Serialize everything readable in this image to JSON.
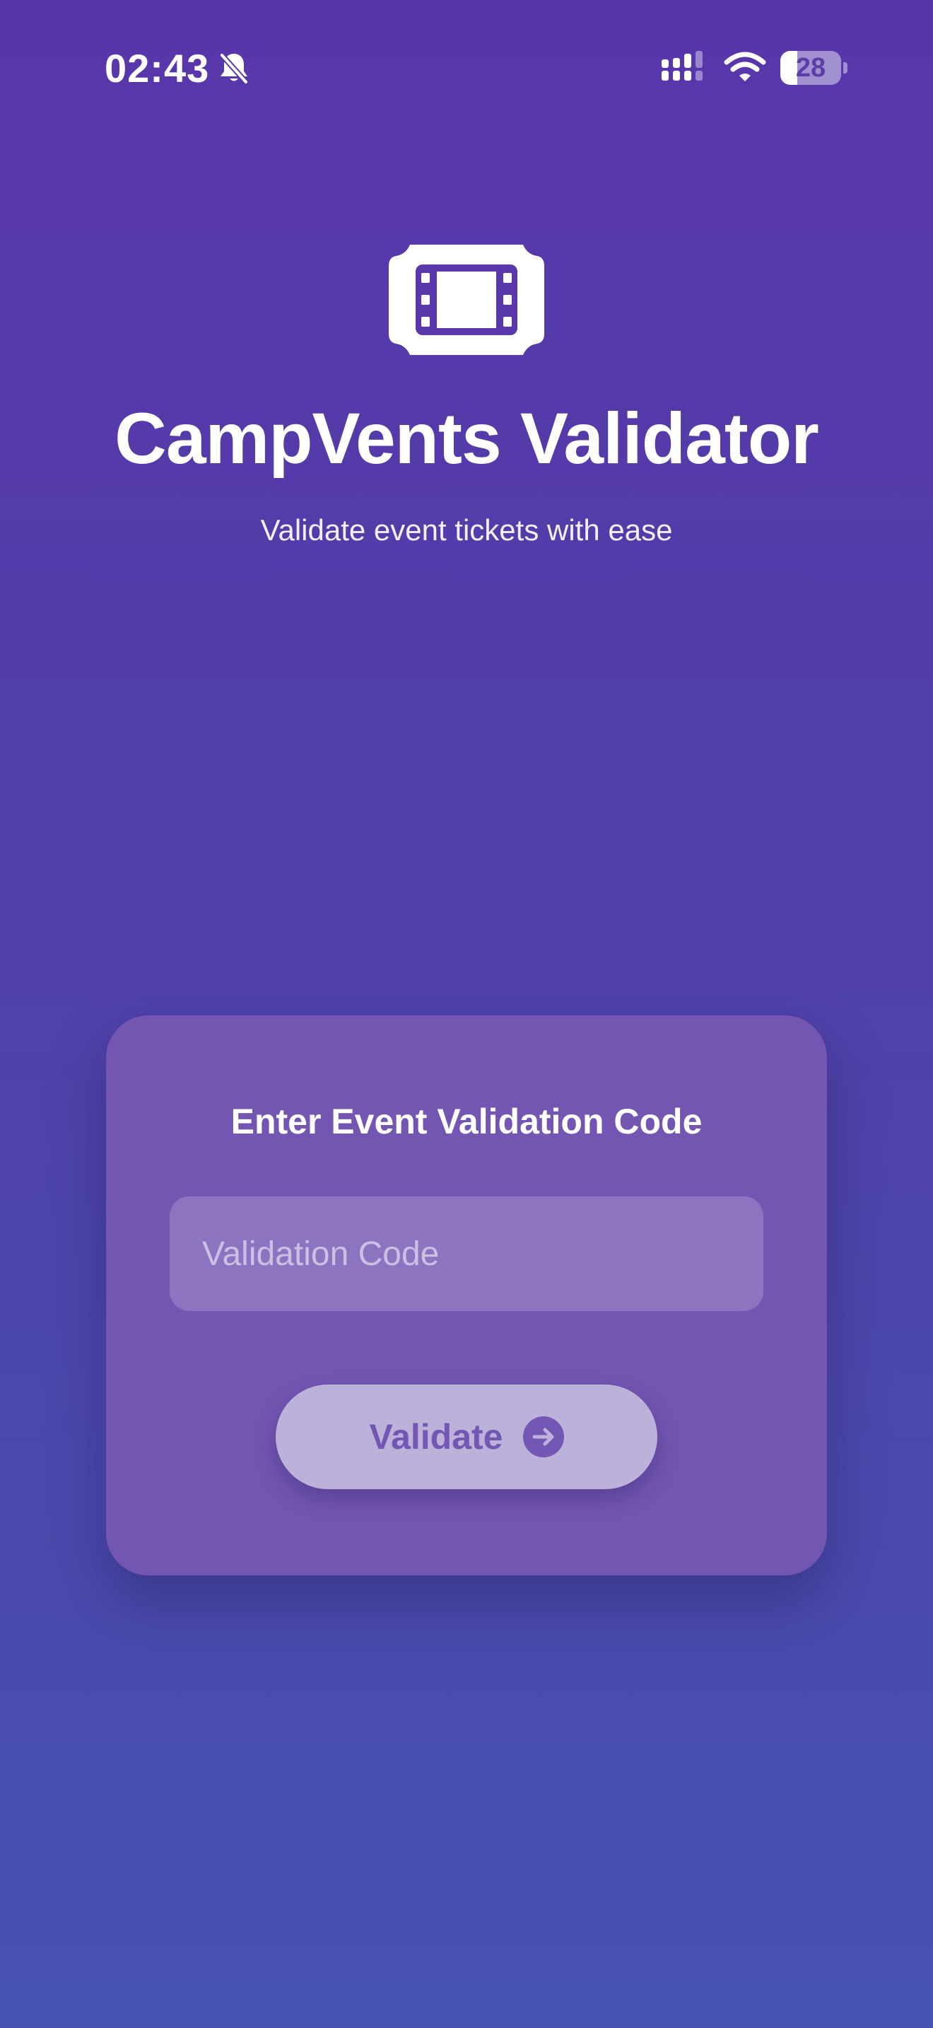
{
  "status_bar": {
    "time": "02:43",
    "battery_level": "28",
    "battery_fraction": 0.28,
    "icons": [
      "bell-slash-icon",
      "cellular-signal-icon",
      "wifi-icon",
      "battery-icon"
    ]
  },
  "header": {
    "logo_icon": "film-ticket-icon",
    "title": "CampVents Validator",
    "subtitle": "Validate event tickets with ease"
  },
  "card": {
    "title": "Enter Event Validation Code",
    "input": {
      "value": "",
      "placeholder": "Validation Code"
    },
    "validate_button": {
      "label": "Validate",
      "icon": "arrow-right-circle-icon"
    }
  },
  "colors": {
    "background_top": "#5836aa",
    "background_bottom": "#4652b0",
    "card": "#7356b2",
    "button": "#bcb1d9",
    "button_text": "#7357b4"
  }
}
